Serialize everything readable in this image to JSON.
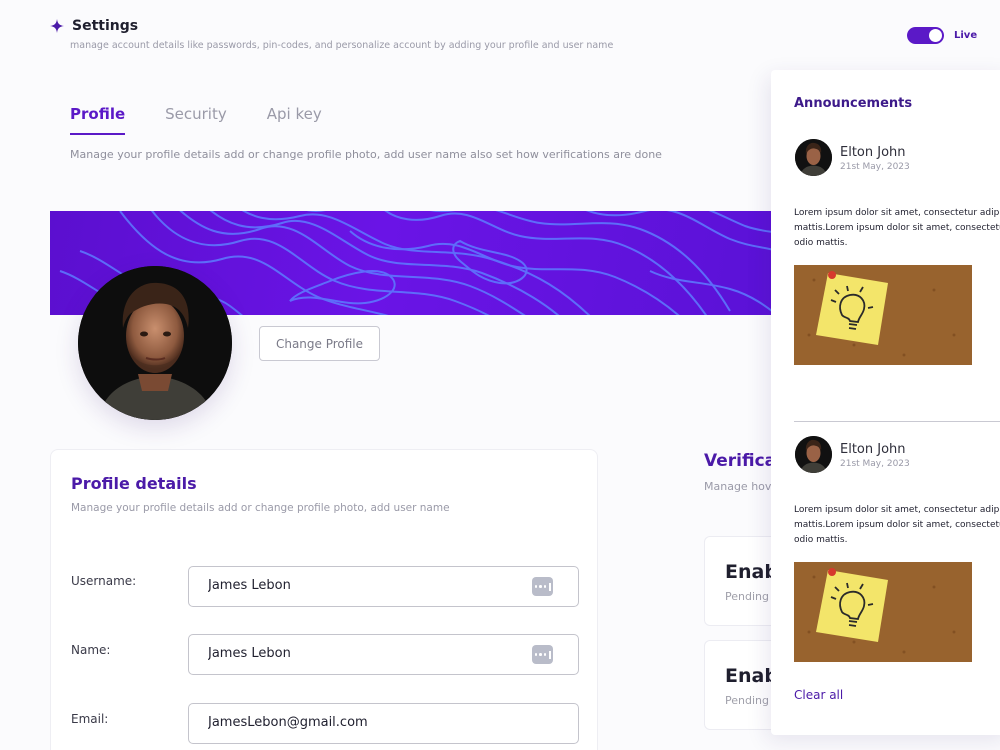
{
  "header": {
    "title": "Settings",
    "subtitle": "manage account details like passwords, pin-codes, and personalize account by adding your profile and user name",
    "live_label": "Live",
    "live_on": true
  },
  "tabs": [
    {
      "label": "Profile",
      "active": true
    },
    {
      "label": "Security",
      "active": false
    },
    {
      "label": "Api key",
      "active": false
    }
  ],
  "tabs_description": "Manage your profile details add or change profile photo, add user name also set how verifications are done",
  "profile": {
    "change_button": "Change Profile"
  },
  "profile_details": {
    "title": "Profile details",
    "description": "Manage your profile details add or change profile photo, add user name",
    "fields": [
      {
        "label": "Username:",
        "value": "James Lebon"
      },
      {
        "label": "Name:",
        "value": "James Lebon"
      },
      {
        "label": "Email:",
        "value": "JamesLebon@gmail.com"
      }
    ]
  },
  "verification": {
    "title": "Verifica",
    "description": "Manage hov",
    "cards": [
      {
        "title": "Enab",
        "status": "Pending"
      },
      {
        "title": "Enab",
        "status": "Pending"
      }
    ]
  },
  "announcements": {
    "title": "Announcements",
    "posts": [
      {
        "name": "Elton John",
        "date": "21st May, 2023",
        "text_lines": [
          "Lorem ipsum dolor sit amet, consectetur adipisci",
          "mattis.Lorem ipsum dolor sit amet, consectetur a",
          "odio mattis."
        ]
      },
      {
        "name": "Elton John",
        "date": "21st May, 2023",
        "text_lines": [
          "Lorem ipsum dolor sit amet, consectetur adipisci",
          "mattis.Lorem ipsum dolor sit amet, consectetur a",
          "odio mattis."
        ]
      }
    ],
    "clear_label": "Clear all"
  },
  "colors": {
    "brand": "#4b1aa8",
    "accent": "#5b19c7",
    "banner": "#6a14e6"
  },
  "icons": [
    "sparkle-icon",
    "more-dots-icon"
  ]
}
